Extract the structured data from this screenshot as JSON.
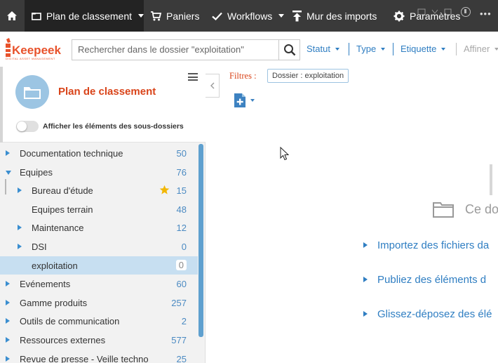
{
  "nav": {
    "home_icon": "home-icon",
    "items": [
      {
        "label": "Plan de classement",
        "icon": "folder-icon",
        "active": true
      },
      {
        "label": "Paniers",
        "icon": "cart-icon"
      },
      {
        "label": "Workflows",
        "icon": "check-icon"
      },
      {
        "label": "Mur des imports",
        "icon": "upload-icon"
      },
      {
        "label": "Paramètres",
        "icon": "gear-icon"
      }
    ]
  },
  "header": {
    "logo_text": "Keepeek",
    "logo_tagline": "DIGITAL ASSET MANAGEMENT",
    "search_placeholder": "Rechercher dans le dossier \"exploitation\"",
    "filters": [
      "Statut",
      "Type",
      "Etiquette",
      "Affiner"
    ]
  },
  "sidebar": {
    "title": "Plan de classement",
    "toggle_label": "Afficher les éléments des sous-dossiers",
    "items": [
      {
        "label": "Documentation technique",
        "count": "50",
        "level": 0,
        "expander": "right"
      },
      {
        "label": "Equipes",
        "count": "76",
        "level": 0,
        "expander": "down"
      },
      {
        "label": "Bureau d'étude",
        "count": "15",
        "level": 1,
        "expander": "right",
        "star": true
      },
      {
        "label": "Equipes terrain",
        "count": "48",
        "level": 1,
        "expander": "none"
      },
      {
        "label": "Maintenance",
        "count": "12",
        "level": 1,
        "expander": "right"
      },
      {
        "label": "DSI",
        "count": "0",
        "level": 1,
        "expander": "right"
      },
      {
        "label": "exploitation",
        "count": "0",
        "level": 1,
        "expander": "none",
        "selected": true
      },
      {
        "label": "Evénements",
        "count": "60",
        "level": 0,
        "expander": "right"
      },
      {
        "label": "Gamme produits",
        "count": "257",
        "level": 0,
        "expander": "right"
      },
      {
        "label": "Outils de communication",
        "count": "2",
        "level": 0,
        "expander": "right"
      },
      {
        "label": "Ressources externes",
        "count": "577",
        "level": 0,
        "expander": "right"
      },
      {
        "label": "Revue de presse - Veille techno",
        "count": "25",
        "level": 0,
        "expander": "right"
      }
    ]
  },
  "main": {
    "filters_label": "Filtres :",
    "chip": "Dossier : exploitation",
    "empty_title": "Ce do",
    "hints": [
      "Importez des fichiers da",
      "Publiez des éléments d",
      "Glissez-déposez des élé"
    ]
  },
  "colors": {
    "accent": "#d9441a",
    "link": "#2f7ec2",
    "topbar": "#3a3a3a",
    "selected_row": "#c7dff1"
  }
}
